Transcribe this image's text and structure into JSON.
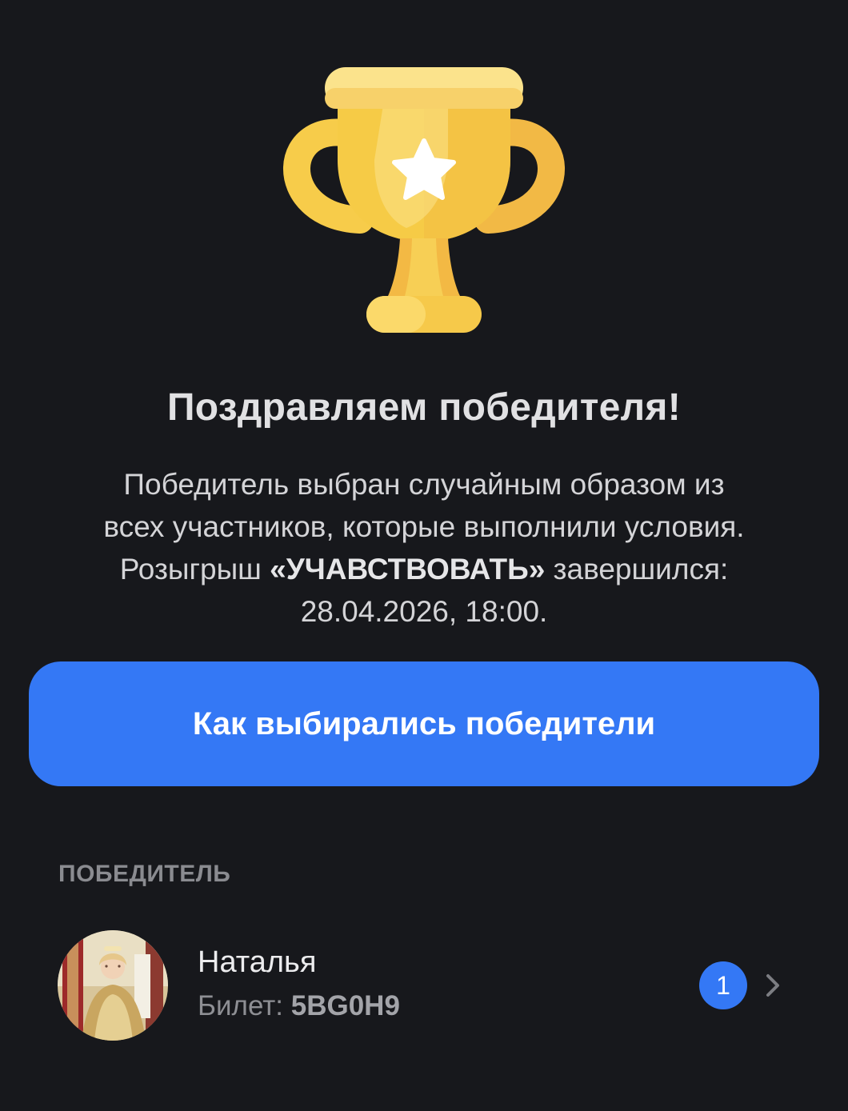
{
  "headline": "Поздравляем победителя!",
  "description": {
    "line1": "Победитель выбран случайным образом из",
    "line2": "всех участников, которые выполнили условия.",
    "line3_before": "Розыгрыш ",
    "giveaway_name": "«УЧАВСТВОВАТЬ»",
    "line3_after": " завершился:",
    "line4": "28.04.2026, 18:00."
  },
  "how_selected_button": "Как выбирались победители",
  "winners_section": {
    "label": "ПОБЕДИТЕЛЬ",
    "winner": {
      "name": "Наталья",
      "ticket_label": "Билет: ",
      "ticket_code": "5BG0H9",
      "place": "1"
    }
  },
  "icons": {
    "trophy": "trophy-icon",
    "star": "star-icon",
    "chevron": "chevron-right-icon"
  },
  "colors": {
    "background": "#17181c",
    "accent": "#3478f5",
    "trophy_gold": "#f6cb46",
    "trophy_light": "#fbe38c"
  }
}
